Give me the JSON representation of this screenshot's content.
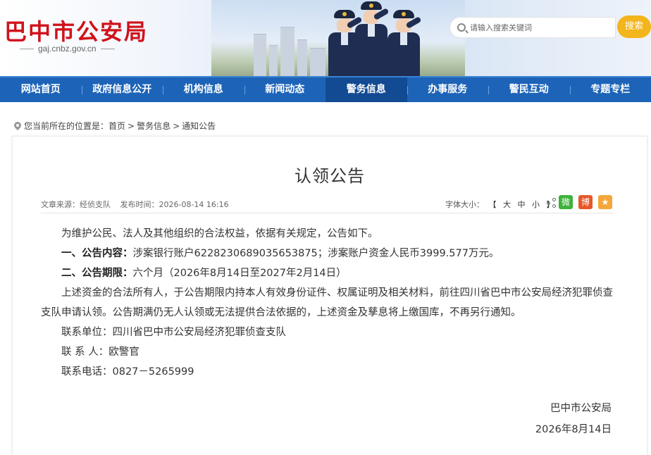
{
  "header": {
    "title": "巴中市公安局",
    "domain": "gaj.cnbz.gov.cn",
    "search_placeholder": "请输入搜索关键词",
    "search_button": "搜索"
  },
  "nav": {
    "items": [
      "网站首页",
      "政府信息公开",
      "机构信息",
      "新闻动态",
      "警务信息",
      "办事服务",
      "警民互动",
      "专题专栏"
    ],
    "active_index": 4
  },
  "breadcrumb": {
    "prefix": "您当前所在的位置是：",
    "items": [
      "首页",
      "警务信息",
      "通知公告"
    ],
    "separator": ">"
  },
  "article": {
    "title": "认领公告",
    "source_label": "文章来源：",
    "source": "经侦支队",
    "time_label": "发布时间：",
    "time": "2026-08-14 16:16",
    "fontsize_label": "字体大小：",
    "fontsize_options": [
      "【",
      "大",
      "中",
      "小",
      "】"
    ],
    "intro": "为维护公民、法人及其他组织的合法权益，依据有关规定，公告如下。",
    "item1_label": "一、公告内容：",
    "item1_text": "涉案银行账户6228230689035653875；涉案账户资金人民币3999.577万元。",
    "item2_label": "二、公告期限：",
    "item2_text": "六个月（2026年8月14日至2027年2月14日）",
    "para": "上述资金的合法所有人，于公告期限内持本人有效身份证件、权属证明及相关材料，前往四川省巴中市公安局经济犯罪侦查支队申请认领。公告期满仍无人认领或无法提供合法依据的，上述资金及孳息将上缴国库，不再另行通知。",
    "contact_unit": "联系单位：四川省巴中市公安局经济犯罪侦查支队",
    "contact_person": "联 系 人：欧警官",
    "contact_phone": "联系电话：0827－5265999",
    "signature": "巴中市公安局",
    "date": "2026年8月14日"
  },
  "share": {
    "wechat_glyph": "微",
    "weibo_glyph": "博",
    "fav_glyph": "★"
  },
  "colors": {
    "brand_red": "#d0121b",
    "nav_blue": "#1d64b8",
    "nav_active": "#124b93",
    "search_yellow": "#f3b51c"
  }
}
